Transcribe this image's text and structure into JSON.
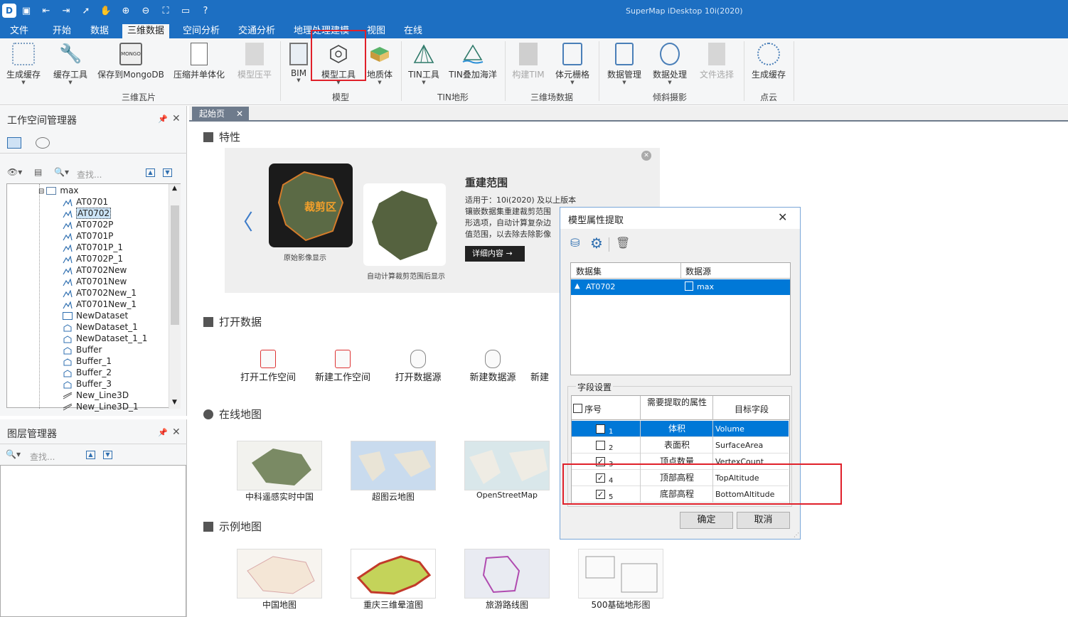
{
  "app": {
    "title": "SuperMap iDesktop 10i(2020)"
  },
  "menu": [
    "文件",
    "开始",
    "数据",
    "三维数据",
    "空间分析",
    "交通分析",
    "地理处理建模",
    "视图",
    "在线"
  ],
  "ribbon": {
    "buttons": [
      "生成缓存",
      "缓存工具",
      "保存到MongoDB",
      "压缩并单体化",
      "模型压平",
      "BIM",
      "模型工具",
      "地质体",
      "TIN工具",
      "TIN叠加海洋",
      "构建TIM",
      "体元栅格",
      "数据管理",
      "数据处理",
      "文件选择",
      "生成缓存"
    ],
    "groups": [
      "三维瓦片",
      "模型",
      "TIN地形",
      "三维场数据",
      "倾斜摄影",
      "点云"
    ]
  },
  "workspace": {
    "title": "工作空间管理器",
    "search_placeholder": "查找...",
    "root": "max",
    "items": [
      "AT0701",
      "AT0702",
      "AT0702P",
      "AT0701P",
      "AT0701P_1",
      "AT0702P_1",
      "AT0702New",
      "AT0701New",
      "AT0702New_1",
      "AT0701New_1",
      "NewDataset",
      "NewDataset_1",
      "NewDataset_1_1",
      "Buffer",
      "Buffer_1",
      "Buffer_2",
      "Buffer_3",
      "New_Line3D",
      "New_Line3D_1"
    ]
  },
  "layers": {
    "title": "图层管理器",
    "search_placeholder": "查找..."
  },
  "tab": {
    "label": "起始页"
  },
  "start": {
    "features_title": "特性",
    "banner": {
      "img1_overlay": "裁剪区",
      "caption1": "原始影像显示",
      "caption2": "自动计算裁剪范围后显示",
      "title": "重建范围",
      "text_lines": [
        "适用于：10i(2020) 及以上版本",
        "镶嵌数据集重建裁剪范围",
        "形选项，自动计算复杂边",
        "值范围，以去除去除影像"
      ],
      "button": "详细内容"
    },
    "open_title": "打开数据",
    "open_items": [
      "打开工作空间",
      "新建工作空间",
      "打开数据源",
      "新建数据源",
      "新建"
    ],
    "online_title": "在线地图",
    "online_maps": [
      "中科遥感实时中国",
      "超图云地图",
      "OpenStreetMap"
    ],
    "sample_title": "示例地图",
    "sample_maps": [
      "中国地图",
      "重庆三维晕渲图",
      "旅游路线图",
      "500基础地形图"
    ]
  },
  "dialog": {
    "title": "模型属性提取",
    "table_headers": [
      "数据集",
      "数据源"
    ],
    "rows": [
      {
        "dataset": "AT0702",
        "source": "max"
      }
    ],
    "field_group": "字段设置",
    "field_headers": [
      "序号",
      "需要提取的属性",
      "目标字段"
    ],
    "fields": [
      {
        "index": "1",
        "attr": "体积",
        "target": "Volume",
        "checked": false
      },
      {
        "index": "2",
        "attr": "表面积",
        "target": "SurfaceArea",
        "checked": false
      },
      {
        "index": "3",
        "attr": "顶点数量",
        "target": "VertexCount",
        "checked": true
      },
      {
        "index": "4",
        "attr": "顶部高程",
        "target": "TopAltitude",
        "checked": true
      },
      {
        "index": "5",
        "attr": "底部高程",
        "target": "BottomAltitude",
        "checked": true
      }
    ],
    "ok": "确定",
    "cancel": "取消"
  },
  "colors": {
    "accent": "#1d6fc2",
    "selection": "#0078d7",
    "highlight": "#e0202a"
  }
}
